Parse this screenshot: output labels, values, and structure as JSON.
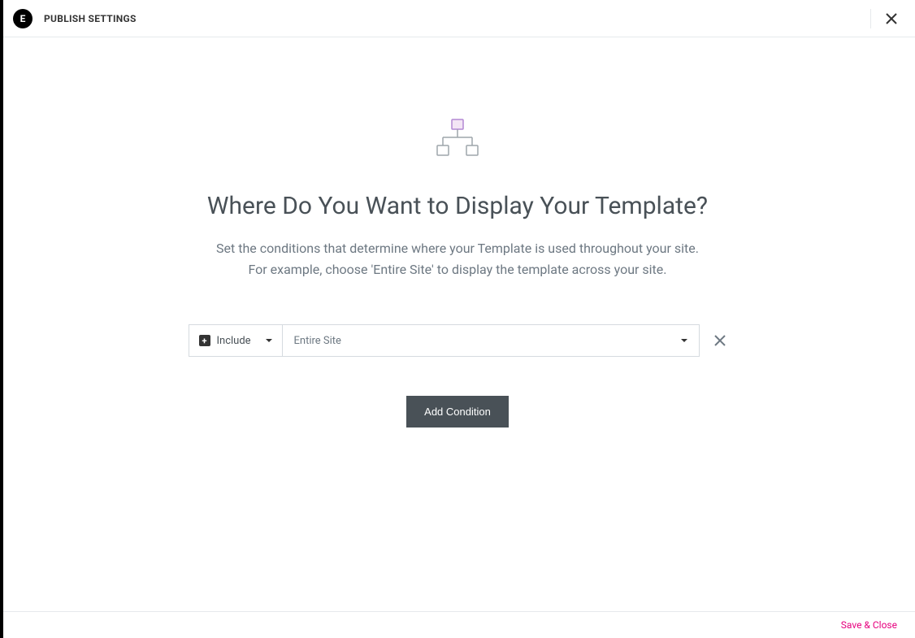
{
  "header": {
    "title": "PUBLISH SETTINGS",
    "logo_letter": "E"
  },
  "main": {
    "heading": "Where Do You Want to Display Your Template?",
    "description_line1": "Set the conditions that determine where your Template is used throughout your site.",
    "description_line2": "For example, choose 'Entire Site' to display the template across your site."
  },
  "condition": {
    "type_label": "Include",
    "scope_label": "Entire Site"
  },
  "buttons": {
    "add_condition": "Add Condition"
  },
  "footer": {
    "save_close": "Save & Close"
  }
}
